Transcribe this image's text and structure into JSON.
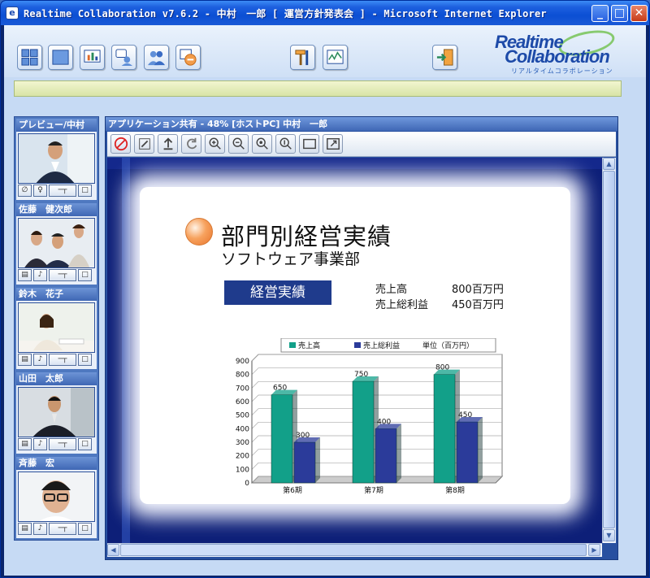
{
  "window": {
    "icon_glyph": "e",
    "title": "Realtime Collaboration v7.6.2 - 中村　一郎 [ 運営方針発表会 ] - Microsoft Internet Explorer",
    "controls": {
      "minimize": "_",
      "maximize": "□",
      "close": "✕"
    }
  },
  "toolbar": {
    "buttons": [
      {
        "name": "layout-4-icon"
      },
      {
        "name": "layout-1-icon"
      },
      {
        "name": "presentation-icon"
      },
      {
        "name": "chat-icon"
      },
      {
        "name": "participants-icon"
      },
      {
        "name": "record-icon"
      },
      {
        "name": "tools-icon"
      },
      {
        "name": "whiteboard-icon"
      },
      {
        "name": "exit-icon"
      }
    ],
    "logo": {
      "line1": "Realtime",
      "line2": "Collaboration",
      "line3": "リアルタイムコラボレーション"
    }
  },
  "participants": [
    {
      "name": "プレビュー/中村",
      "controls": [
        "∅",
        "♀",
        "─┬",
        "□"
      ]
    },
    {
      "name": "佐藤　健次郎",
      "controls": [
        "▤",
        "♪",
        "─┬",
        "□"
      ]
    },
    {
      "name": "鈴木　花子",
      "controls": [
        "▤",
        "♪",
        "─┬",
        "□"
      ]
    },
    {
      "name": "山田　太郎",
      "controls": [
        "▤",
        "♪",
        "─┬",
        "□"
      ]
    },
    {
      "name": "斉藤　宏",
      "controls": [
        "▤",
        "♪",
        "─┬",
        "□"
      ]
    }
  ],
  "share": {
    "title": "アプリケーション共有 - 48% [ホストPC] 中村　一郎",
    "tools": [
      "stop-share-icon",
      "annotate-icon",
      "upload-icon",
      "refresh-icon",
      "zoom-in-icon",
      "zoom-out-icon",
      "zoom-fit-icon",
      "zoom-actual-icon",
      "window-icon",
      "fullscreen-icon"
    ],
    "slide": {
      "title": "部門別経営実績",
      "subtitle": "ソフトウェア事業部",
      "badge": "経営実績",
      "kpis": [
        {
          "label": "売上高",
          "value": "800百万円"
        },
        {
          "label": "売上総利益",
          "value": "450百万円"
        }
      ],
      "colors": {
        "sales": "#12a089",
        "profit": "#2b3b9a",
        "badge": "#1f3b8c"
      }
    },
    "scroll": {
      "up": "▲",
      "down": "▼",
      "left": "◀",
      "right": "▶"
    }
  },
  "chart_data": {
    "type": "bar",
    "categories": [
      "第6期",
      "第7期",
      "第8期"
    ],
    "series": [
      {
        "name": "売上高",
        "values": [
          650,
          750,
          800
        ]
      },
      {
        "name": "売上総利益",
        "values": [
          300,
          400,
          450
        ]
      }
    ],
    "labels": [
      "650",
      "300",
      "750",
      "400",
      "800",
      "450"
    ],
    "legend_note": "単位（百万円）",
    "ylim": [
      0,
      900
    ],
    "yticks": [
      0,
      100,
      200,
      300,
      400,
      500,
      600,
      700,
      800,
      900
    ],
    "grid": true,
    "legend": "top"
  }
}
